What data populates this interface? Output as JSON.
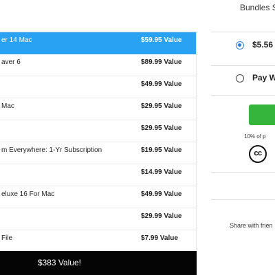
{
  "bundle": {
    "items": [
      {
        "name": "er 14 Mac",
        "value": "$59.95 Value",
        "selected": true
      },
      {
        "name": "aver 6",
        "value": "$89.99 Value",
        "selected": false
      },
      {
        "name": "",
        "value": "$49.99 Value",
        "selected": false
      },
      {
        "name": "Mac",
        "value": "$29.95 Value",
        "selected": false
      },
      {
        "name": "",
        "value": "$29.95 Value",
        "selected": false
      },
      {
        "name": "m Everywhere: 1-Yr Subscription",
        "value": "$19.95 Value",
        "selected": false
      },
      {
        "name": "",
        "value": "$14.99 Value",
        "selected": false
      },
      {
        "name": "eluxe 16 For Mac",
        "value": "$49.99 Value",
        "selected": false
      },
      {
        "name": "",
        "value": "$29.99 Value",
        "selected": false
      },
      {
        "name": "File",
        "value": "$7.99 Value",
        "selected": false
      }
    ],
    "total": "$383 Value!"
  },
  "purchase_panel": {
    "title": "Bundles S",
    "options": [
      {
        "label": "$5.56",
        "checked": true
      },
      {
        "label": "Pay W",
        "checked": false
      }
    ],
    "percent_text": "10% of p",
    "cc_icon_text": "cc",
    "share_text": "Share with frien"
  },
  "colors": {
    "selected_row": "#2aa2f4",
    "buy_button": "#35b53b",
    "total_bar": "#050505",
    "radio_checked": "#2f7fd8"
  },
  "icons": {
    "license": "creative-commons-icon"
  }
}
